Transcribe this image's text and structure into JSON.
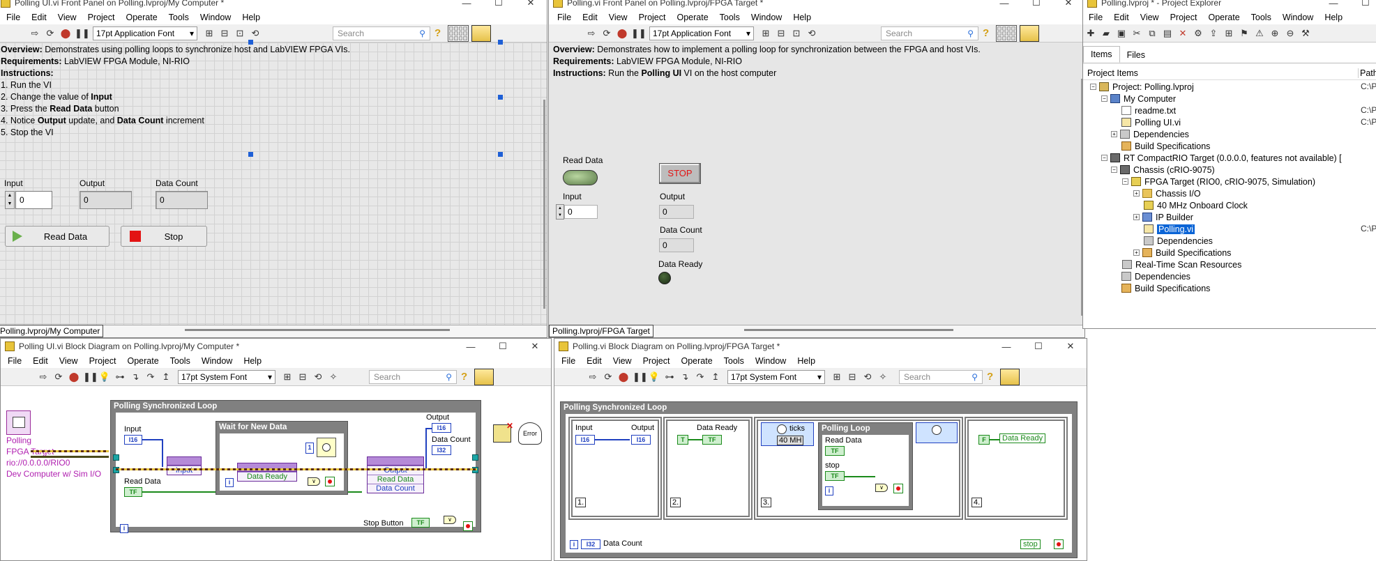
{
  "polling_ui_fp": {
    "title": "Polling UI.vi Front Panel on Polling.lvproj/My Computer *",
    "menu": [
      "File",
      "Edit",
      "View",
      "Project",
      "Operate",
      "Tools",
      "Window",
      "Help"
    ],
    "font": "17pt Application Font",
    "search_placeholder": "Search",
    "overview_label": "Overview:",
    "overview_text": " Demonstrates using polling loops to synchronize host and LabVIEW FPGA VIs.",
    "requirements_label": "Requirements:",
    "requirements_text": " LabVIEW FPGA Module, NI-RIO",
    "instructions_label": "Instructions:",
    "steps": [
      "1. Run the VI",
      "2. Change the value of ",
      "3. Press the ",
      "4. Notice ",
      "5. Stop the VI"
    ],
    "step2_bold": "Input",
    "step3_bold": "Read Data",
    "step3_tail": " button",
    "step4_bold1": "Output",
    "step4_mid": " update, and ",
    "step4_bold2": "Data Count",
    "step4_tail": " increment",
    "input_label": "Input",
    "input_value": "0",
    "output_label": "Output",
    "output_value": "0",
    "data_count_label": "Data Count",
    "data_count_value": "0",
    "read_data_button": "Read Data",
    "stop_button": "Stop",
    "context": "Polling.lvproj/My Computer"
  },
  "polling_fp": {
    "title": "Polling.vi Front Panel on Polling.lvproj/FPGA Target *",
    "menu": [
      "File",
      "Edit",
      "View",
      "Project",
      "Operate",
      "Tools",
      "Window",
      "Help"
    ],
    "font": "17pt Application Font",
    "search_placeholder": "Search",
    "overview_label": "Overview:",
    "overview_text": " Demonstrates how to implement a polling loop for synchronization between the FPGA and host VIs.",
    "requirements_label": "Requirements:",
    "requirements_text": " LabVIEW FPGA Module, NI-RIO",
    "instructions_label": "Instructions:",
    "instructions_pre": " Run the ",
    "instructions_bold": "Polling UI",
    "instructions_post": " VI on the host computer",
    "read_data_label": "Read Data",
    "stop_label": "STOP",
    "input_label": "Input",
    "input_value": "0",
    "output_label": "Output",
    "output_value": "0",
    "data_count_label": "Data Count",
    "data_count_value": "0",
    "data_ready_label": "Data Ready",
    "context": "Polling.lvproj/FPGA Target"
  },
  "project_explorer": {
    "title": "Polling.lvproj * - Project Explorer",
    "menu": [
      "File",
      "Edit",
      "View",
      "Project",
      "Operate",
      "Tools",
      "Window",
      "Help"
    ],
    "tabs": [
      "Items",
      "Files"
    ],
    "col_items": "Project Items",
    "col_path": "Path",
    "tree": [
      {
        "label": "Project: Polling.lvproj",
        "path": "C:\\Pr"
      },
      {
        "label": "My Computer",
        "path": ""
      },
      {
        "label": "readme.txt",
        "path": "C:\\Pr"
      },
      {
        "label": "Polling UI.vi",
        "path": "C:\\Pr"
      },
      {
        "label": "Dependencies",
        "path": ""
      },
      {
        "label": "Build Specifications",
        "path": ""
      },
      {
        "label": "RT CompactRIO Target (0.0.0.0, features not available) [",
        "path": ""
      },
      {
        "label": "Chassis (cRIO-9075)",
        "path": ""
      },
      {
        "label": "FPGA Target (RIO0, cRIO-9075, Simulation)",
        "path": ""
      },
      {
        "label": "Chassis I/O",
        "path": ""
      },
      {
        "label": "40 MHz Onboard Clock",
        "path": ""
      },
      {
        "label": "IP Builder",
        "path": ""
      },
      {
        "label": "Polling.vi",
        "path": "C:\\Pr"
      },
      {
        "label": "Dependencies",
        "path": ""
      },
      {
        "label": "Build Specifications",
        "path": ""
      },
      {
        "label": "Real-Time Scan Resources",
        "path": ""
      },
      {
        "label": "Dependencies",
        "path": ""
      },
      {
        "label": "Build Specifications",
        "path": ""
      }
    ]
  },
  "polling_ui_bd": {
    "title": "Polling UI.vi Block Diagram on Polling.lvproj/My Computer *",
    "menu": [
      "File",
      "Edit",
      "View",
      "Project",
      "Operate",
      "Tools",
      "Window",
      "Help"
    ],
    "font": "17pt System Font",
    "search_placeholder": "Search",
    "loop_title": "Polling Synchronized Loop",
    "inner_title": "Wait for New Data",
    "input": "Input",
    "read_data": "Read Data",
    "output": "Output",
    "data_count": "Data Count",
    "stop_button": "Stop Button",
    "data_ready": "Data Ready",
    "node_input": "Input",
    "node_output": "Output",
    "node_read_data": "Read Data",
    "node_data_count": "Data Count",
    "i16": "I16",
    "i32": "I32",
    "tf": "TF",
    "one": "1",
    "iter": "i",
    "ref_lines": [
      "Polling",
      "FPGA Target",
      "rio://0.0.0.0/RIO0",
      "Dev Computer w/ Sim I/O"
    ],
    "error": "Error"
  },
  "polling_bd": {
    "title": "Polling.vi Block Diagram on Polling.lvproj/FPGA Target *",
    "menu": [
      "File",
      "Edit",
      "View",
      "Project",
      "Operate",
      "Tools",
      "Window",
      "Help"
    ],
    "font": "17pt System Font",
    "search_placeholder": "Search",
    "loop_title": "Polling Synchronized Loop",
    "input": "Input",
    "output": "Output",
    "data_ready": "Data Ready",
    "ticks": "ticks",
    "mhz": "40 MH",
    "polling_loop": "Polling Loop",
    "read_data": "Read Data",
    "stop": "stop",
    "frames": [
      "1.",
      "2.",
      "3.",
      "4."
    ],
    "data_count": "Data Count",
    "data_ready_out": "Data Ready",
    "stop_out": "stop",
    "i16": "I16",
    "i32": "I32",
    "tf": "TF",
    "t": "T",
    "f": "F",
    "iter": "i"
  }
}
